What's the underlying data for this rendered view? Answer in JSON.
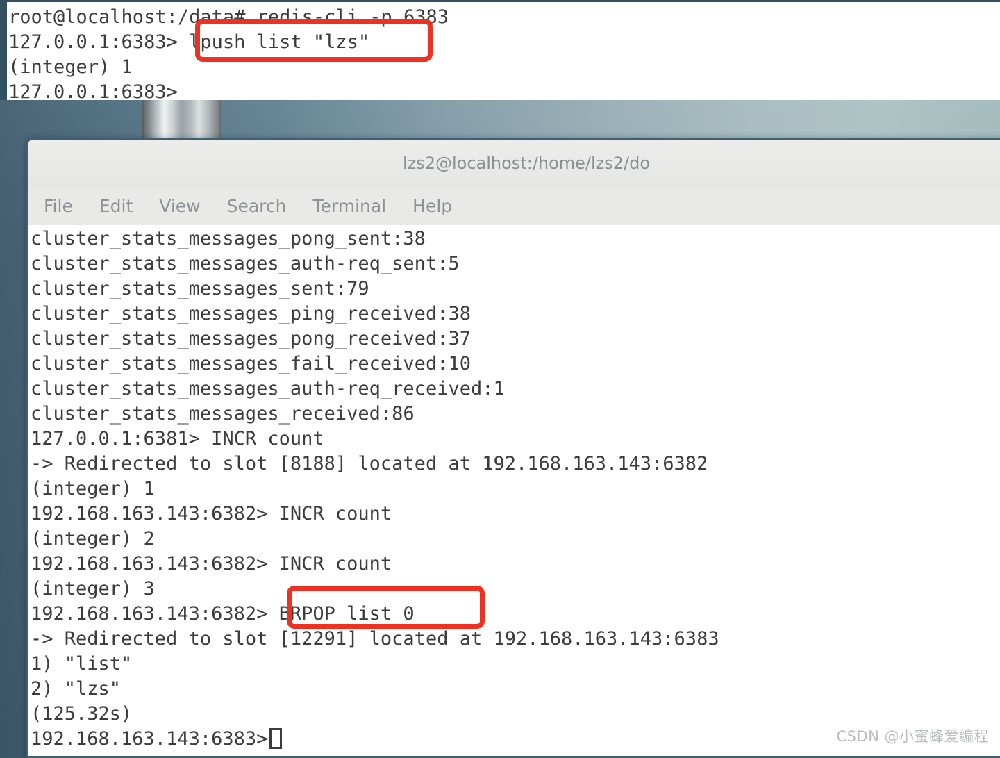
{
  "desktop": {
    "object_name": "metal-cylinder-decoration"
  },
  "top_terminal": {
    "name": "redis-cli-terminal-top",
    "lines": [
      "root@localhost:/data# redis-cli -p 6383",
      "127.0.0.1:6383> lpush list \"lzs\"",
      "(integer) 1",
      "127.0.0.1:6383>"
    ]
  },
  "bottom_window": {
    "title": "lzs2@localhost:/home/lzs2/do",
    "menu": [
      {
        "label": "File"
      },
      {
        "label": "Edit"
      },
      {
        "label": "View"
      },
      {
        "label": "Search"
      },
      {
        "label": "Terminal"
      },
      {
        "label": "Help"
      }
    ],
    "terminal_lines": [
      "cluster_stats_messages_pong_sent:38",
      "cluster_stats_messages_auth-req_sent:5",
      "cluster_stats_messages_sent:79",
      "cluster_stats_messages_ping_received:38",
      "cluster_stats_messages_pong_received:37",
      "cluster_stats_messages_fail_received:10",
      "cluster_stats_messages_auth-req_received:1",
      "cluster_stats_messages_received:86",
      "127.0.0.1:6381> INCR count",
      "-> Redirected to slot [8188] located at 192.168.163.143:6382",
      "(integer) 1",
      "192.168.163.143:6382> INCR count",
      "(integer) 2",
      "192.168.163.143:6382> INCR count",
      "(integer) 3",
      "192.168.163.143:6382> BRPOP list 0",
      "-> Redirected to slot [12291] located at 192.168.163.143:6383",
      "1) \"list\"",
      "2) \"lzs\"",
      "(125.32s)"
    ],
    "prompt_line": "192.168.163.143:6383>"
  },
  "annotations": {
    "color": "#ef3124",
    "boxes": [
      {
        "label": "lpush list \"lzs\"",
        "name": "highlight-lpush-command"
      },
      {
        "label": "BRPOP list 0",
        "name": "highlight-brpop-command"
      }
    ]
  },
  "watermark": {
    "text": "CSDN @小蜜蜂爱编程"
  }
}
